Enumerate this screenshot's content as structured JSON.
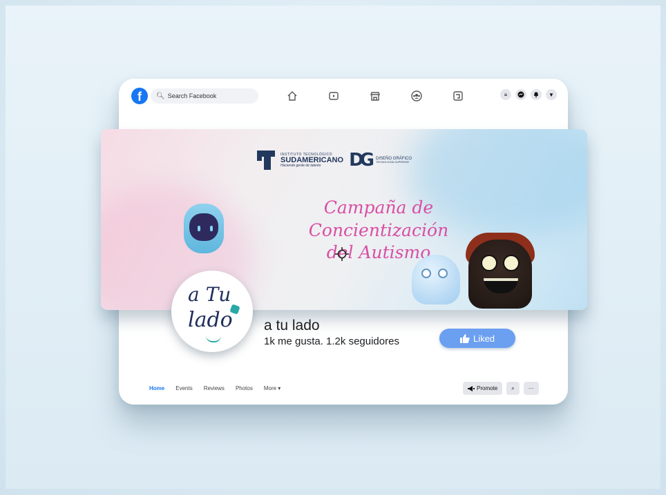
{
  "topbar": {
    "search_placeholder": "Search Facebook",
    "nav_icons": [
      "home-icon",
      "video-icon",
      "marketplace-icon",
      "groups-icon",
      "gaming-icon"
    ],
    "right_icons": [
      "menu-icon",
      "messenger-icon",
      "notifications-icon",
      "account-dropdown-icon"
    ]
  },
  "cover": {
    "institute_small": "INSTITUTO TECNOLÓGICO",
    "institute_name": "SUDAMERICANO",
    "institute_tagline": "Haciendo gente de talento",
    "dg_mark": "DG",
    "dg_title": "DISEÑO GRÁFICO",
    "dg_subtitle": "TECNOLOGÍA SUPERIOR",
    "headline_line1": "Campaña de Concientización",
    "headline_line2": "del Autismo"
  },
  "avatar": {
    "line1": "a Tu",
    "line2": "lado"
  },
  "page": {
    "name": "a tu lado",
    "stats": "1k me gusta. 1.2k seguidores",
    "liked_label": "Liked"
  },
  "tabs": [
    "Home",
    "Events",
    "Reviews",
    "Photos",
    "More ▾"
  ],
  "actions": {
    "promote": "Promote",
    "search": "⌕",
    "more": "···"
  },
  "colors": {
    "facebook_blue": "#1877f2",
    "liked_button": "#6b9ff0",
    "headline_pink": "#d94ea4",
    "brand_navy": "#22385e"
  }
}
